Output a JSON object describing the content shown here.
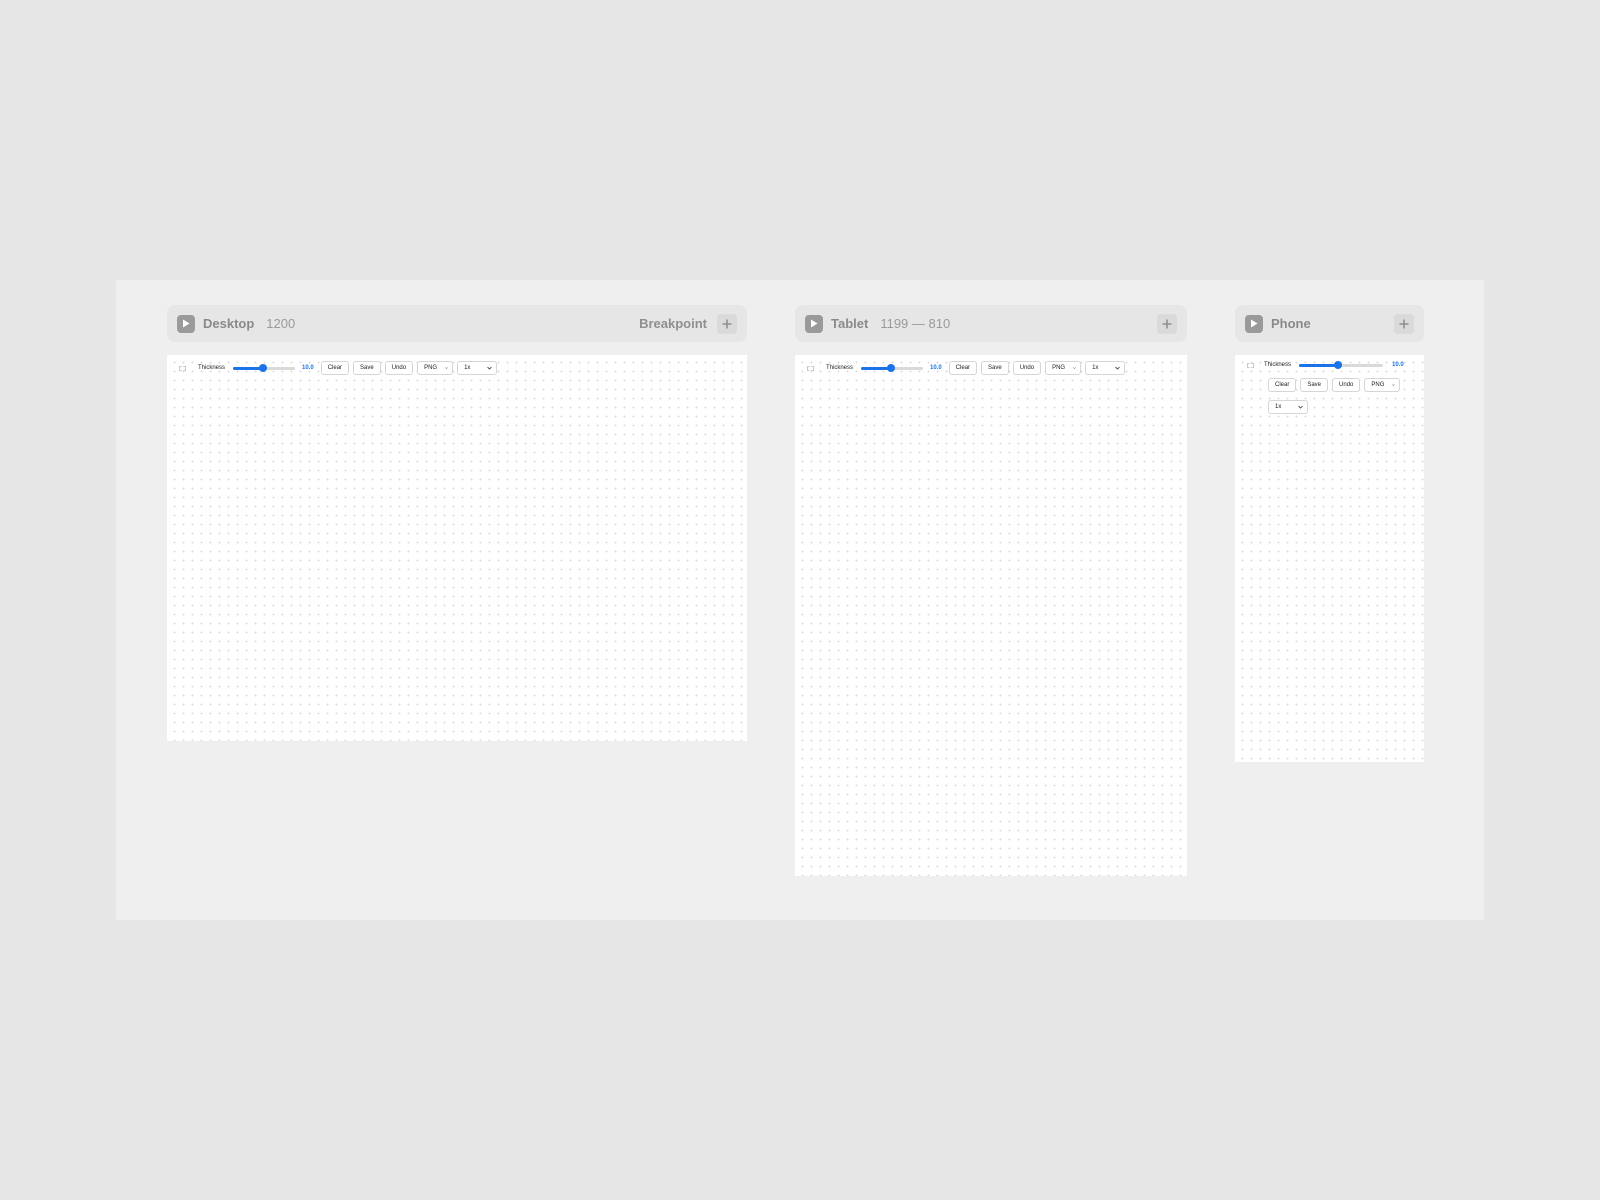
{
  "breakpoints": [
    {
      "name": "Desktop",
      "range": "1200",
      "action_label": "Breakpoint",
      "toolbar": {
        "thickness_label": "Thickness",
        "thickness_value": "10.0",
        "slider_fraction": 0.48,
        "clear_label": "Clear",
        "save_label": "Save",
        "undo_label": "Undo",
        "format_value": "PNG",
        "scale_value": "1x"
      }
    },
    {
      "name": "Tablet",
      "range": "1199 — 810",
      "action_label": "",
      "toolbar": {
        "thickness_label": "Thickness",
        "thickness_value": "10.0",
        "slider_fraction": 0.48,
        "clear_label": "Clear",
        "save_label": "Save",
        "undo_label": "Undo",
        "format_value": "PNG",
        "scale_value": "1x"
      }
    },
    {
      "name": "Phone",
      "range": "",
      "action_label": "",
      "toolbar": {
        "thickness_label": "Thickness",
        "thickness_value": "10.0",
        "slider_fraction": 0.47,
        "clear_label": "Clear",
        "save_label": "Save",
        "undo_label": "Undo",
        "format_value": "PNG",
        "scale_value": "1x"
      }
    }
  ],
  "icons": {
    "play": "play-icon",
    "add": "plus-icon",
    "drag": "drag-handle-icon",
    "dropdown": "chevron-down-icon"
  },
  "colors": {
    "accent": "#1a73e8",
    "page_background": "#e6e6e6",
    "canvas_background": "#efefef",
    "header_background": "#e6e6e6"
  }
}
